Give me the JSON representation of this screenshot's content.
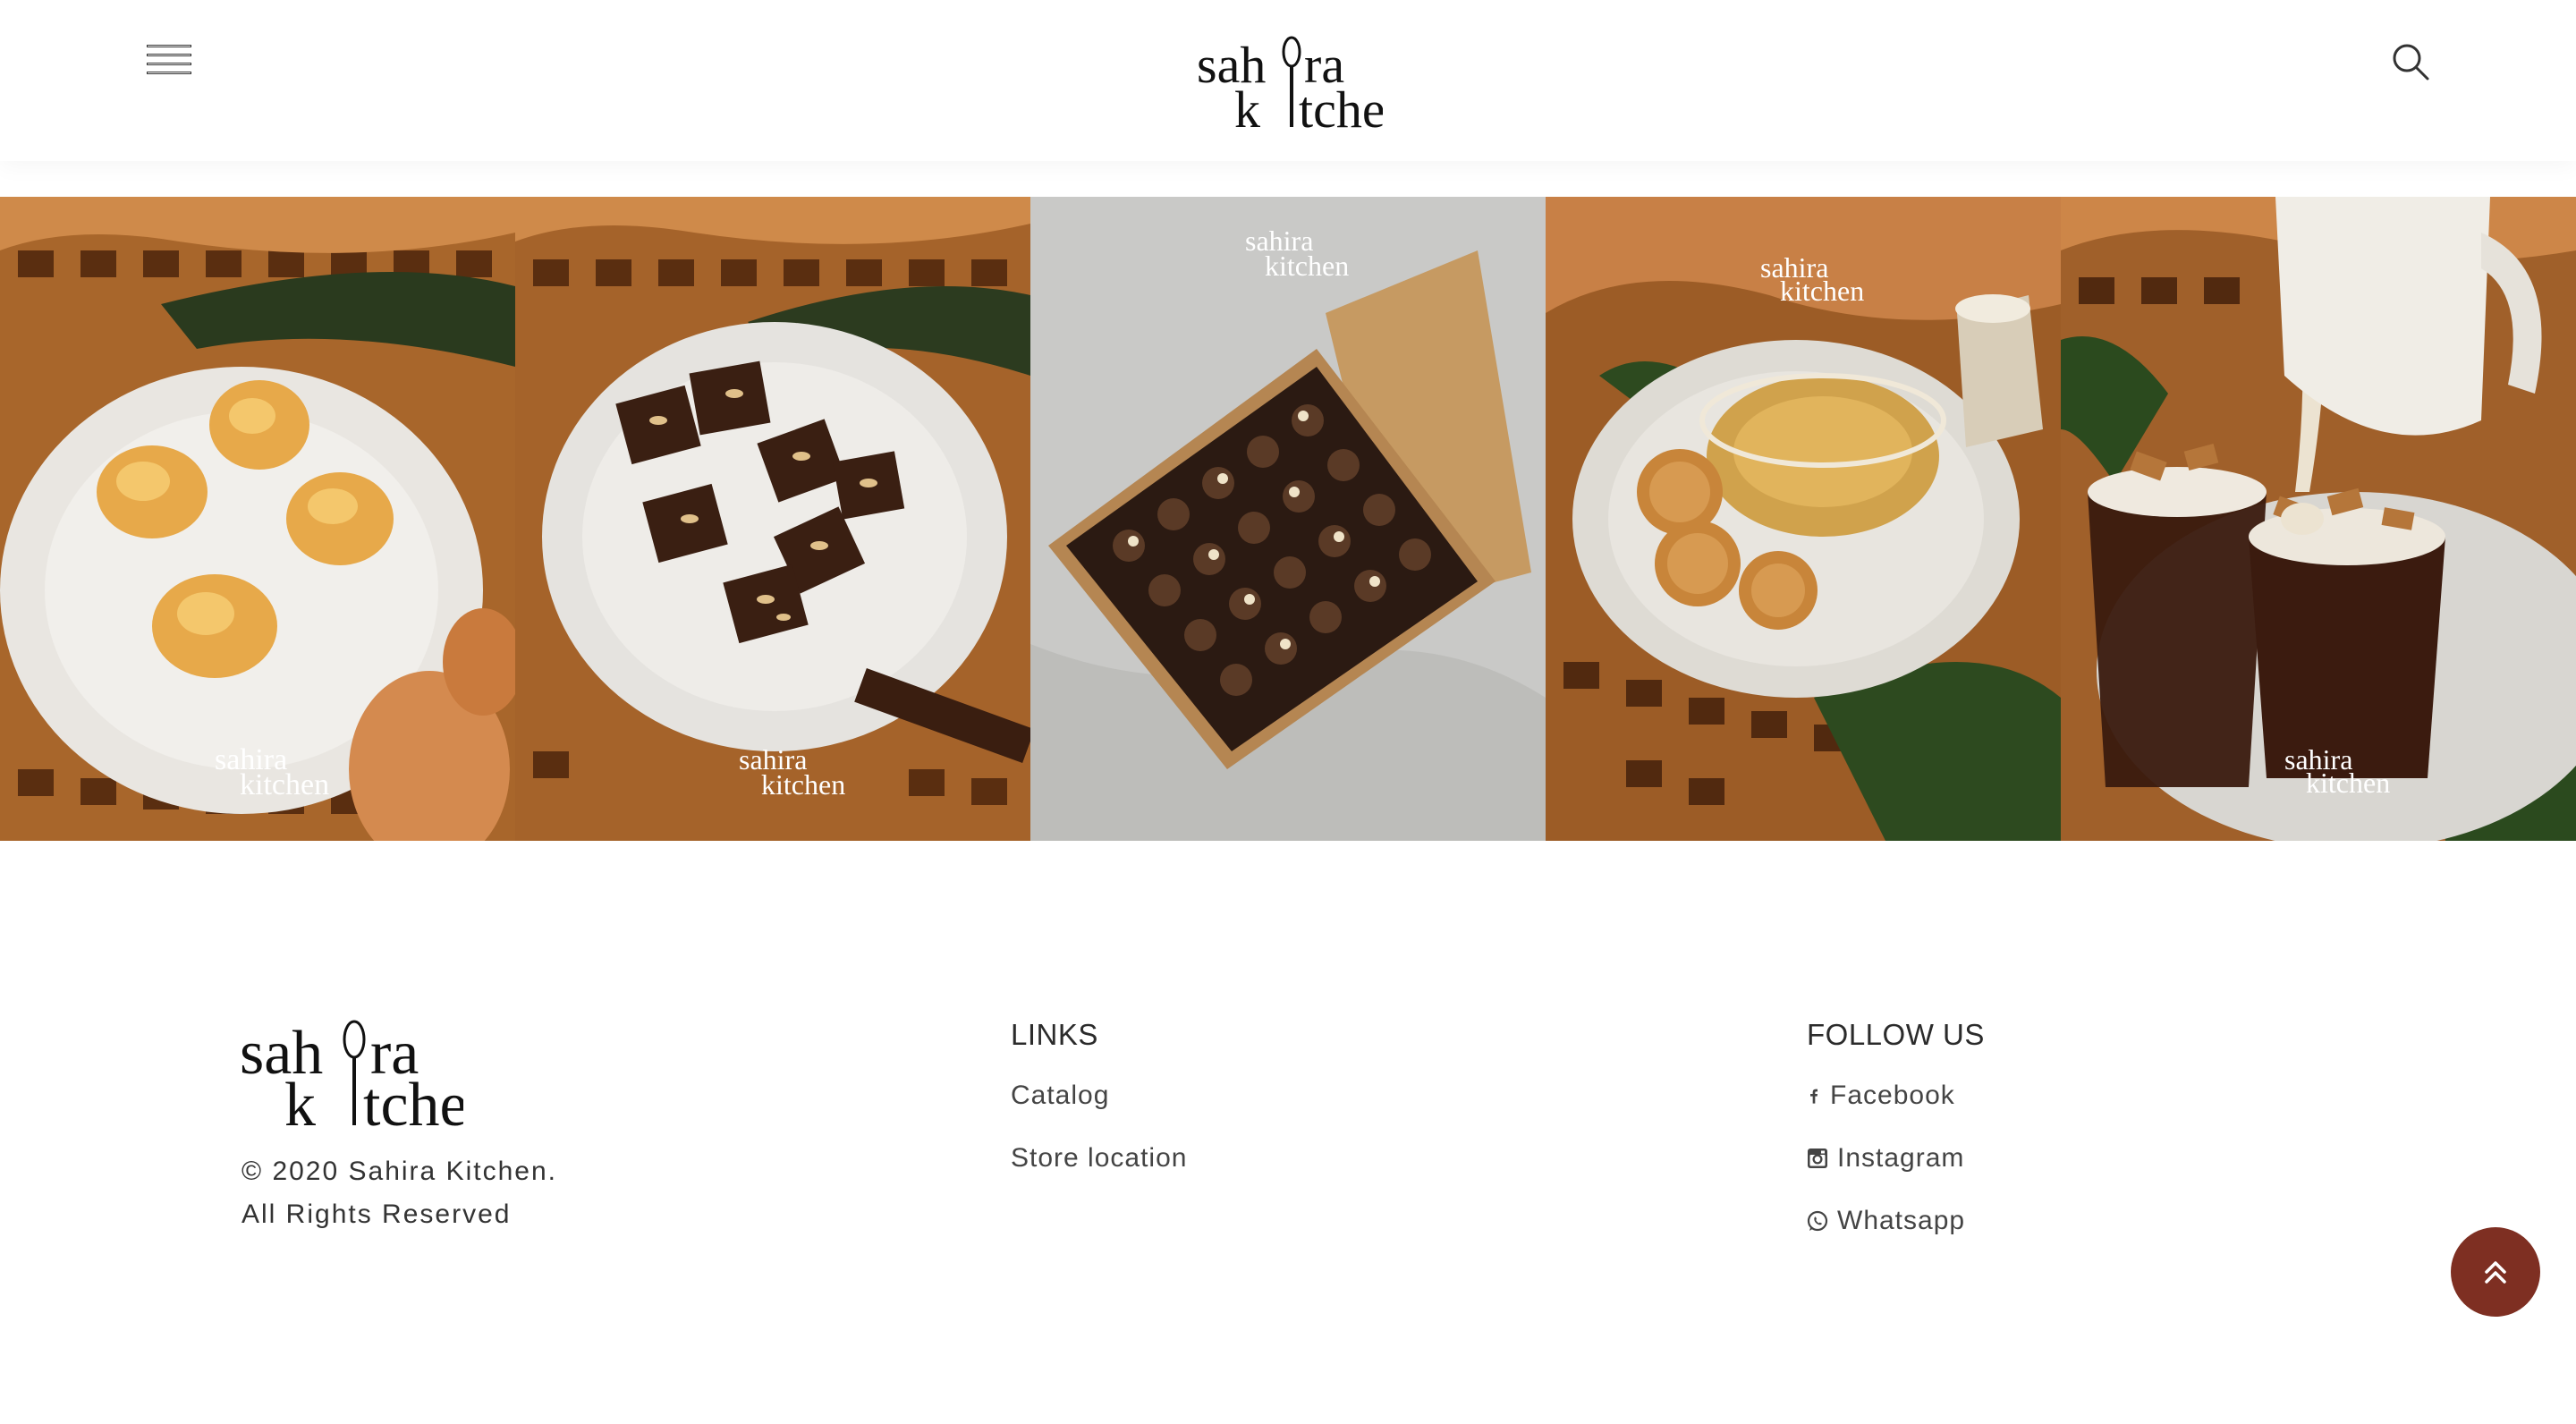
{
  "header": {
    "logo_alt": "sahira kitchen",
    "menu_icon": "hamburger-icon",
    "search_icon": "search-icon"
  },
  "gallery": {
    "items": [
      {
        "name": "cream-puffs",
        "watermark": "sahira kitchen"
      },
      {
        "name": "brownie-bites",
        "watermark": "sahira kitchen"
      },
      {
        "name": "boxed-brownies",
        "watermark": "sahira kitchen"
      },
      {
        "name": "biscuit-pudding",
        "watermark": "sahira kitchen"
      },
      {
        "name": "chocolate-cups",
        "watermark": "sahira kitchen"
      }
    ]
  },
  "footer": {
    "copyright_line1": "© 2020 Sahira Kitchen.",
    "copyright_line2": "All Rights Reserved",
    "links": {
      "title": "LINKS",
      "items": [
        "Catalog",
        "Store location"
      ]
    },
    "follow": {
      "title": "FOLLOW US",
      "items": [
        {
          "label": "Facebook",
          "icon": "facebook-icon"
        },
        {
          "label": "Instagram",
          "icon": "instagram-icon"
        },
        {
          "label": "Whatsapp",
          "icon": "whatsapp-icon"
        }
      ]
    }
  },
  "back_to_top": {
    "icon": "double-chevron-up-icon",
    "color": "#7e2f22"
  }
}
